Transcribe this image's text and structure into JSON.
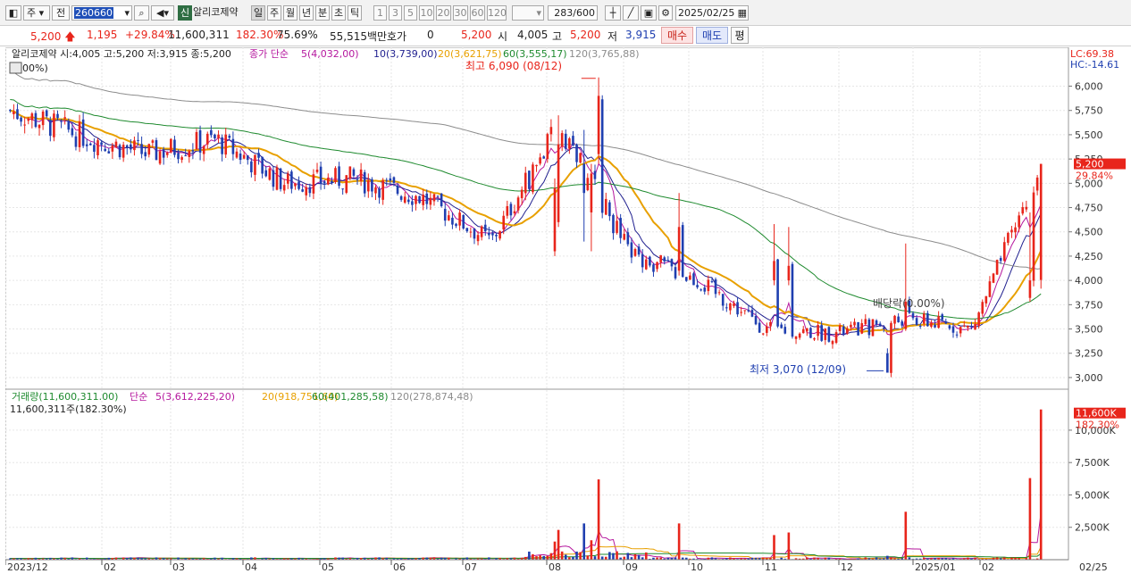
{
  "toolbar": {
    "period_select": "주",
    "prev_label": "전",
    "code": "260660",
    "credit_badge": "신",
    "stock_name": "알리코제약",
    "periods": [
      "일",
      "주",
      "월",
      "년",
      "분",
      "초",
      "틱"
    ],
    "active_period": "일",
    "intervals": [
      "1",
      "3",
      "5",
      "10",
      "20",
      "30",
      "60",
      "120"
    ],
    "count": "283",
    "count_total": "/600",
    "date": "2025/02/25"
  },
  "quote": {
    "price": "5,200",
    "change": "1,195",
    "change_pct": "+29.84%",
    "volume": "11,600,311",
    "volume_pct": "182.30%",
    "rate": "75.69%",
    "amount": "55,515백만",
    "hoga_label": "호가",
    "hoga_value": "0",
    "hoga_price": "5,200",
    "open_label": "시",
    "open": "4,005",
    "high_label": "고",
    "high": "5,200",
    "low_label": "저",
    "low": "3,915",
    "buy_label": "매수",
    "sell_label": "매도",
    "avg_label": "평"
  },
  "chart_data": {
    "type": "candlestick",
    "price_legend": {
      "title": "알리코제약 시:4,005 고:5,200 저:3,915 종:5,200",
      "ma_label": "종가 단순",
      "ma5": "5(4,032,00)",
      "ma10": "10(3,739,00)",
      "ma20": "20(3,621,75)",
      "ma60": "60(3,555,17)",
      "ma120": "120(3,765,88)",
      "pct_label": "00%)"
    },
    "price_axis": {
      "ticks": [
        3000,
        3250,
        3500,
        3750,
        4000,
        4250,
        4500,
        4750,
        5000,
        5250,
        5500,
        5750,
        6000
      ],
      "tick_labels": [
        "3,000",
        "3,250",
        "3,500",
        "3,750",
        "4,000",
        "4,250",
        "4,500",
        "4,750",
        "5,000",
        "5,250",
        "5,500",
        "5,750",
        "6,000"
      ],
      "ylim": [
        2880,
        6400
      ],
      "last_price": 5200,
      "last_price_label": "5,200",
      "last_change_label": "29.84%",
      "lc_label": "LC:69.38",
      "hc_label": "HC:-14.61"
    },
    "annotations": {
      "high": "최고 6,090 (08/12)",
      "low": "최저 3,070 (12/09)",
      "ex_rights": "배당락(0.00%)"
    },
    "volume_legend": {
      "title": "거래량(11,600,311.00)",
      "ma_label": "단순",
      "ma5": "5(3,612,225,20)",
      "ma20": "20(918,751,60)",
      "ma60": "60(401,285,58)",
      "ma120": "120(278,874,48)",
      "current": "11,600,311주(182.30%)"
    },
    "volume_axis": {
      "ticks": [
        2500,
        5000,
        7500,
        10000
      ],
      "tick_labels": [
        "2,500K",
        "5,000K",
        "7,500K",
        "10,000K"
      ],
      "ylim": [
        0,
        12200
      ],
      "last_label": "11,600K",
      "last_pct_label": "182.30%"
    },
    "x_axis": {
      "labels": [
        "2023/12",
        "02",
        "03",
        "04",
        "05",
        "06",
        "07",
        "08",
        "09",
        "10",
        "11",
        "12",
        "2025/01",
        "02",
        "02/25"
      ]
    },
    "series": [
      {
        "name": "close",
        "months": [
          "2023/12",
          "02",
          "03",
          "04",
          "05",
          "06",
          "07",
          "08",
          "09",
          "10",
          "11",
          "12",
          "2025/01",
          "02",
          "02/25"
        ],
        "values": [
          5750,
          5500,
          5300,
          5450,
          5000,
          5050,
          4850,
          4400,
          5600,
          4300,
          4000,
          3500,
          3450,
          3600,
          3500,
          5200
        ]
      }
    ],
    "colors": {
      "up": "#e8251b",
      "down": "#1f3fb0",
      "ma5": "#b5179e",
      "ma10": "#1f1f8f",
      "ma20": "#e8a000",
      "ma60": "#1e8a2e",
      "ma120": "#8c8c8c"
    }
  }
}
